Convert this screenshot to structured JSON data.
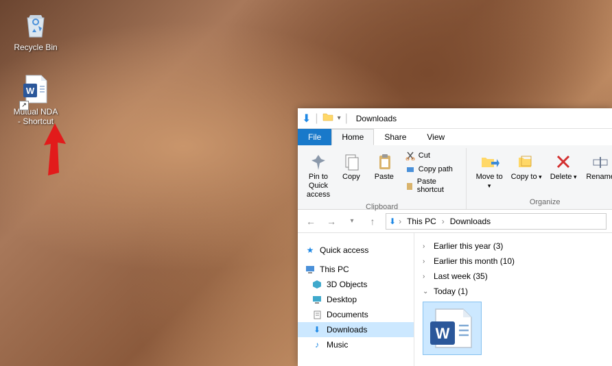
{
  "desktop": {
    "icons": [
      {
        "name": "recycle-bin",
        "label": "Recycle Bin",
        "icon": "recycle-bin-icon"
      },
      {
        "name": "mutual-nda",
        "label": "Mutual NDA - Shortcut",
        "icon": "word-doc-icon",
        "shortcut": true
      }
    ]
  },
  "explorer": {
    "title": "Downloads",
    "tabs": {
      "file": "File",
      "home": "Home",
      "share": "Share",
      "view": "View"
    },
    "ribbon": {
      "pin": "Pin to Quick access",
      "copy": "Copy",
      "paste": "Paste",
      "cut": "Cut",
      "copy_path": "Copy path",
      "paste_shortcut": "Paste shortcut",
      "clipboard_group": "Clipboard",
      "move_to": "Move to",
      "copy_to": "Copy to",
      "delete": "Delete",
      "rename": "Rename",
      "organize_group": "Organize"
    },
    "breadcrumb": {
      "root": "This PC",
      "current": "Downloads"
    },
    "nav": {
      "quick_access": "Quick access",
      "this_pc": "This PC",
      "objects3d": "3D Objects",
      "desktop": "Desktop",
      "documents": "Documents",
      "downloads": "Downloads",
      "music": "Music"
    },
    "groups": [
      {
        "label": "Earlier this year (3)",
        "expanded": false
      },
      {
        "label": "Earlier this month (10)",
        "expanded": false
      },
      {
        "label": "Last week (35)",
        "expanded": false
      },
      {
        "label": "Today (1)",
        "expanded": true
      }
    ]
  }
}
